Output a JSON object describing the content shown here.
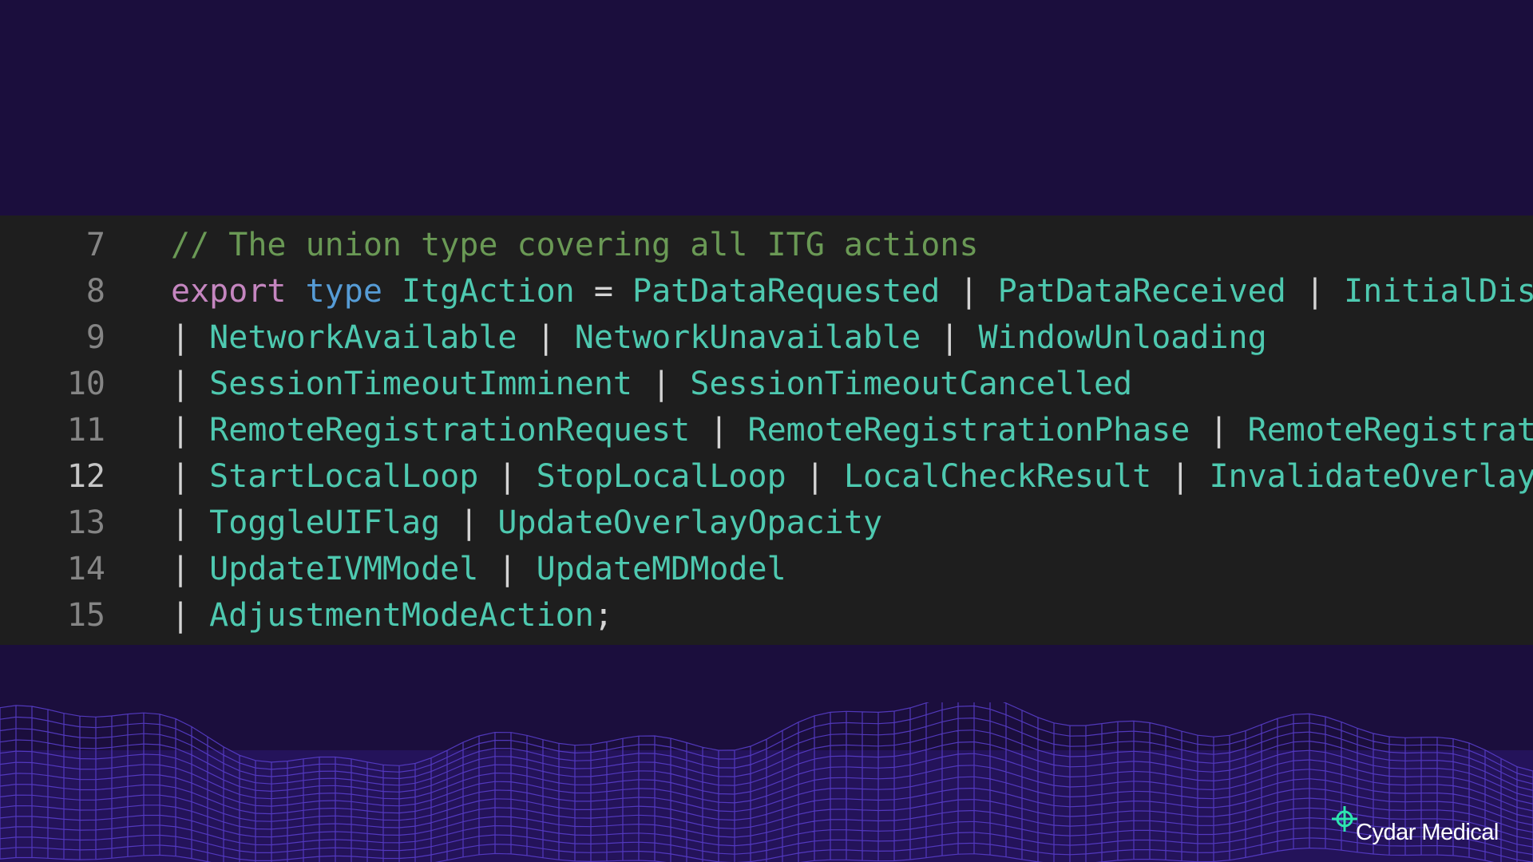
{
  "code": {
    "lines": [
      {
        "number": "7",
        "active": false,
        "tokens": [
          {
            "text": "// The union type covering all ITG actions",
            "kind": "comment"
          }
        ]
      },
      {
        "number": "8",
        "active": false,
        "tokens": [
          {
            "text": "export",
            "kind": "keyword"
          },
          {
            "text": " ",
            "kind": "op"
          },
          {
            "text": "type",
            "kind": "type"
          },
          {
            "text": " ",
            "kind": "op"
          },
          {
            "text": "ItgAction",
            "kind": "ident"
          },
          {
            "text": " = ",
            "kind": "op"
          },
          {
            "text": "PatDataRequested",
            "kind": "ident"
          },
          {
            "text": " | ",
            "kind": "op"
          },
          {
            "text": "PatDataReceived",
            "kind": "ident"
          },
          {
            "text": " | ",
            "kind": "op"
          },
          {
            "text": "InitialDispla",
            "kind": "ident"
          }
        ]
      },
      {
        "number": "9",
        "active": false,
        "tokens": [
          {
            "text": "| ",
            "kind": "op"
          },
          {
            "text": "NetworkAvailable",
            "kind": "ident"
          },
          {
            "text": " | ",
            "kind": "op"
          },
          {
            "text": "NetworkUnavailable",
            "kind": "ident"
          },
          {
            "text": " | ",
            "kind": "op"
          },
          {
            "text": "WindowUnloading",
            "kind": "ident"
          }
        ]
      },
      {
        "number": "10",
        "active": false,
        "tokens": [
          {
            "text": "| ",
            "kind": "op"
          },
          {
            "text": "SessionTimeoutImminent",
            "kind": "ident"
          },
          {
            "text": " | ",
            "kind": "op"
          },
          {
            "text": "SessionTimeoutCancelled",
            "kind": "ident"
          }
        ]
      },
      {
        "number": "11",
        "active": false,
        "tokens": [
          {
            "text": "| ",
            "kind": "op"
          },
          {
            "text": "RemoteRegistrationRequest",
            "kind": "ident"
          },
          {
            "text": " | ",
            "kind": "op"
          },
          {
            "text": "RemoteRegistrationPhase",
            "kind": "ident"
          },
          {
            "text": " | ",
            "kind": "op"
          },
          {
            "text": "RemoteRegistration",
            "kind": "ident"
          }
        ]
      },
      {
        "number": "12",
        "active": true,
        "tokens": [
          {
            "text": "| ",
            "kind": "op"
          },
          {
            "text": "StartLocalLoop",
            "kind": "ident"
          },
          {
            "text": " | ",
            "kind": "op"
          },
          {
            "text": "StopLocalLoop",
            "kind": "ident"
          },
          {
            "text": " | ",
            "kind": "op"
          },
          {
            "text": "LocalCheckResult",
            "kind": "ident"
          },
          {
            "text": " | ",
            "kind": "op"
          },
          {
            "text": "InvalidateOverlay",
            "kind": "ident"
          }
        ]
      },
      {
        "number": "13",
        "active": false,
        "tokens": [
          {
            "text": "| ",
            "kind": "op"
          },
          {
            "text": "ToggleUIFlag",
            "kind": "ident"
          },
          {
            "text": " | ",
            "kind": "op"
          },
          {
            "text": "UpdateOverlayOpacity",
            "kind": "ident"
          }
        ]
      },
      {
        "number": "14",
        "active": false,
        "tokens": [
          {
            "text": "| ",
            "kind": "op"
          },
          {
            "text": "UpdateIVMModel",
            "kind": "ident"
          },
          {
            "text": " | ",
            "kind": "op"
          },
          {
            "text": "UpdateMDModel",
            "kind": "ident"
          }
        ]
      },
      {
        "number": "15",
        "active": false,
        "tokens": [
          {
            "text": "| ",
            "kind": "op"
          },
          {
            "text": "AdjustmentModeAction",
            "kind": "ident"
          },
          {
            "text": ";",
            "kind": "op"
          }
        ]
      }
    ]
  },
  "theme": {
    "background": "#1b0e3d",
    "editor_background": "#1e1e1e",
    "comment": "#6a9955",
    "keyword": "#c586c0",
    "type_keyword": "#569cd6",
    "identifier": "#4ec9b0",
    "terrain": "#5b3fd0",
    "logo_accent": "#2ee6b0"
  },
  "branding": {
    "logo_text": "Cydar Medical",
    "logo_icon": "crosshair-icon"
  }
}
